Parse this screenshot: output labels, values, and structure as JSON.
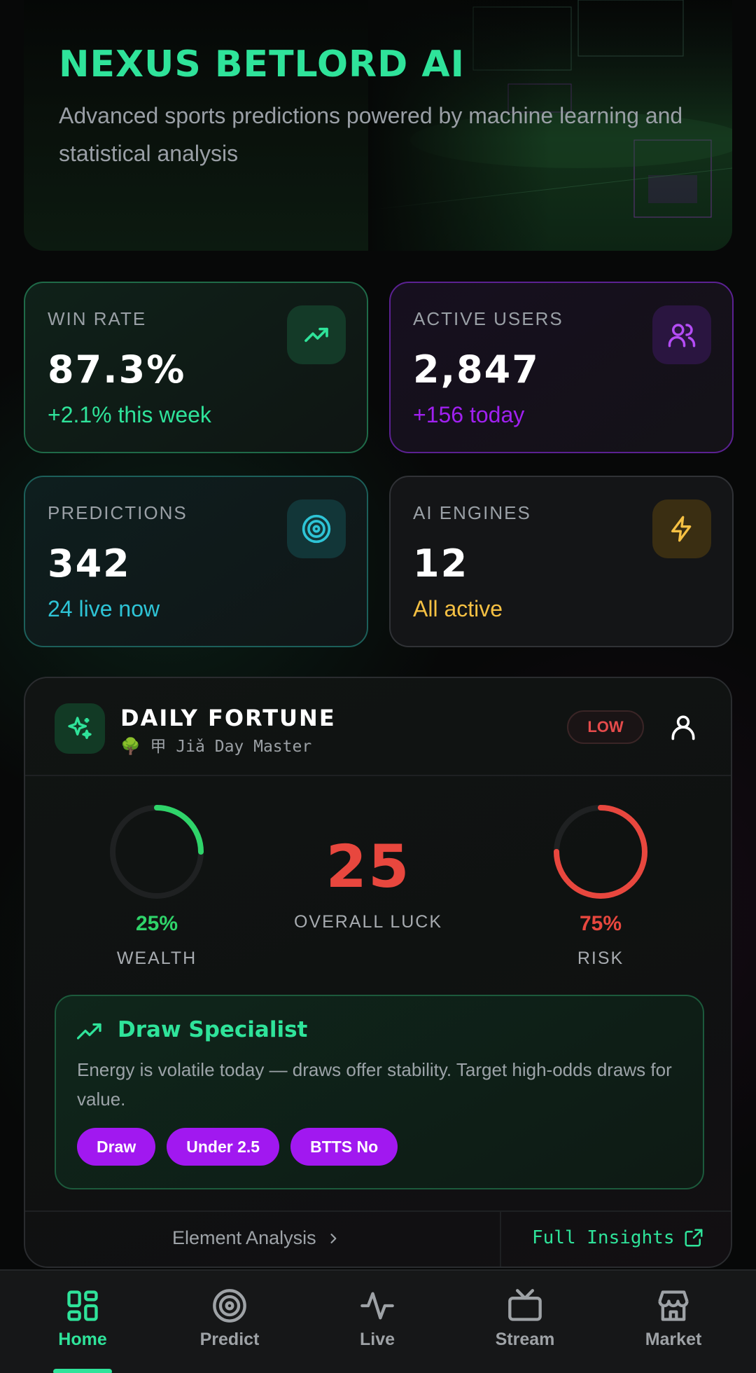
{
  "hero": {
    "title": "NEXUS BETLORD AI",
    "subtitle": "Advanced sports predictions powered by machine learning and statistical analysis"
  },
  "stats": [
    {
      "label": "WIN RATE",
      "value": "87.3%",
      "delta": "+2.1% this week",
      "icon": "trending-up-icon",
      "accent": "#2fe39a"
    },
    {
      "label": "ACTIVE USERS",
      "value": "2,847",
      "delta": "+156 today",
      "icon": "users-icon",
      "accent": "#a020f0"
    },
    {
      "label": "PREDICTIONS",
      "value": "342",
      "delta": "24 live now",
      "icon": "target-icon",
      "accent": "#2ec4d6"
    },
    {
      "label": "AI ENGINES",
      "value": "12",
      "delta": "All active",
      "icon": "lightning-icon",
      "accent": "#f5c043"
    }
  ],
  "fortune": {
    "title": "DAILY FORTUNE",
    "subtitle": "🌳 甲 Jiǎ Day Master",
    "badge": "LOW",
    "wealth": {
      "percent_text": "25%",
      "label": "WEALTH",
      "value": 0.25,
      "color": "#2fd46a"
    },
    "luck": {
      "value": "25",
      "label": "OVERALL LUCK",
      "color": "#e8473e"
    },
    "risk": {
      "percent_text": "75%",
      "label": "RISK",
      "value": 0.75,
      "color": "#e8473e"
    },
    "tip": {
      "title": "Draw Specialist",
      "text": "Energy is volatile today — draws offer stability. Target high-odds draws for value.",
      "chips": [
        "Draw",
        "Under 2.5",
        "BTTS No"
      ]
    },
    "footer": {
      "element_link": "Element Analysis",
      "insights_link": "Full Insights"
    }
  },
  "nav": {
    "items": [
      {
        "label": "Home",
        "icon": "grid-icon",
        "active": true
      },
      {
        "label": "Predict",
        "icon": "target-icon"
      },
      {
        "label": "Live",
        "icon": "pulse-icon"
      },
      {
        "label": "Stream",
        "icon": "tv-icon"
      },
      {
        "label": "Market",
        "icon": "store-icon"
      }
    ]
  }
}
